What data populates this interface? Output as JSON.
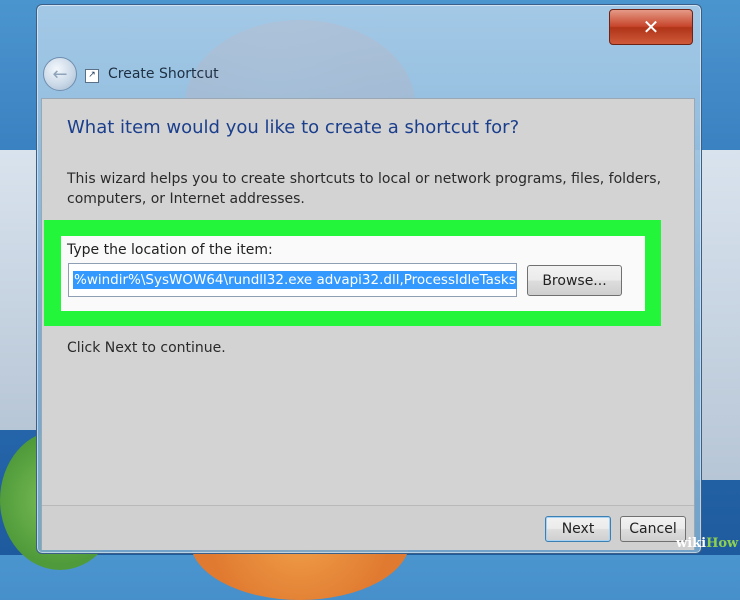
{
  "window": {
    "title": "Create Shortcut",
    "close_glyph": "✕",
    "back_glyph": "←"
  },
  "wizard": {
    "heading": "What item would you like to create a shortcut for?",
    "description": "This wizard helps you to create shortcuts to local or network programs, files, folders, computers, or Internet addresses.",
    "location_label": "Type the location of the item:",
    "location_value": "%windir%\\SysWOW64\\rundll32.exe advapi32.dll,ProcessIdleTasks",
    "browse_label": "Browse...",
    "continue_text": "Click Next to continue."
  },
  "footer": {
    "next_label": "Next",
    "cancel_label": "Cancel"
  },
  "watermark": {
    "prefix": "wiki",
    "suffix": "How"
  },
  "colors": {
    "highlight": "#22f53a",
    "selection": "#3399ff",
    "heading": "#1b3f8c"
  }
}
